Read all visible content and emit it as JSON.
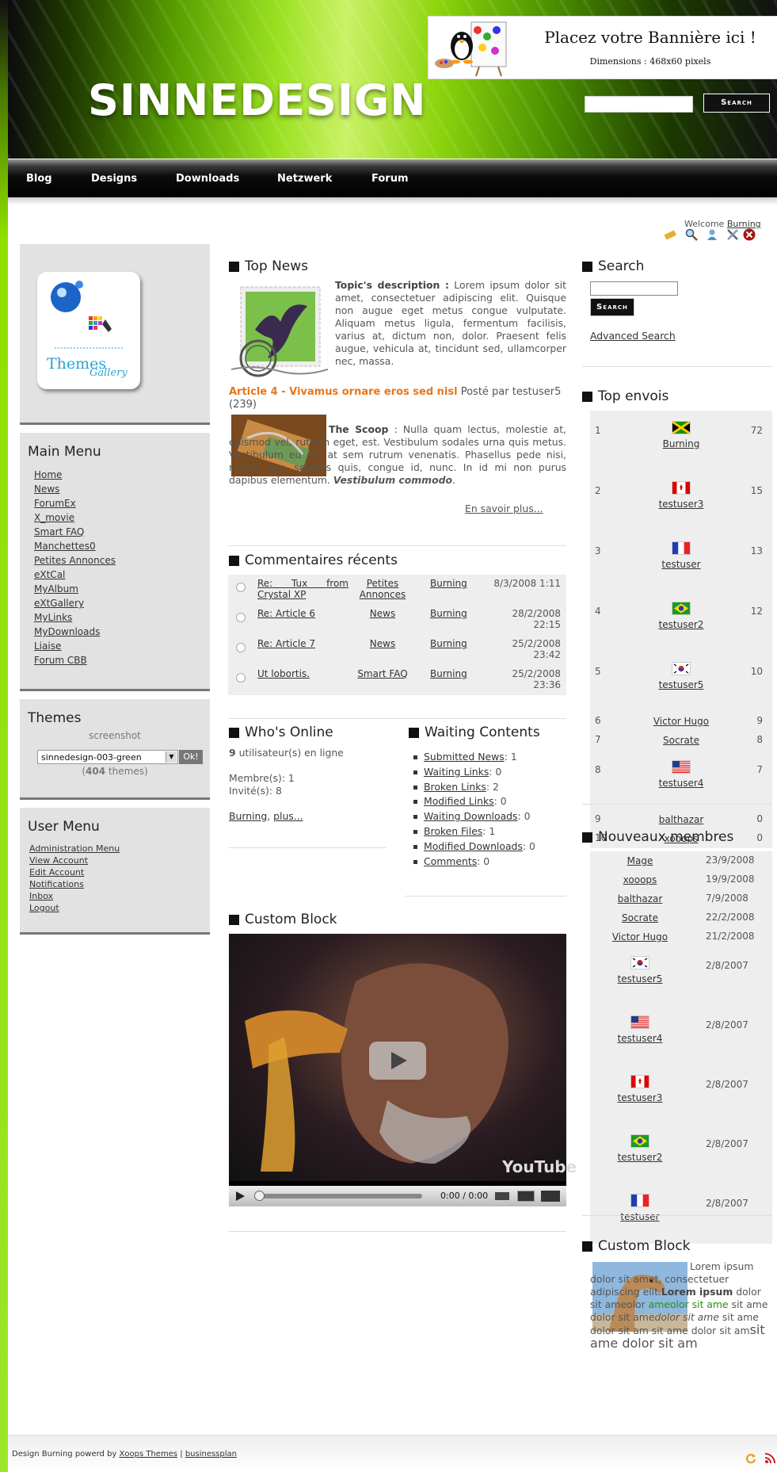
{
  "header": {
    "brand": "SINNEDESIGN",
    "banner": {
      "title": "Placez votre Bannière ici !",
      "dimensions": "Dimensions : 468x60 pixels"
    },
    "search_button": "Search"
  },
  "nav": {
    "items": [
      "Blog",
      "Designs",
      "Downloads",
      "Netzwerk",
      "Forum"
    ]
  },
  "welcome": {
    "prefix": "Welcome",
    "user": "Burning"
  },
  "tool_icons": [
    "pencil-icon",
    "magnifier-icon",
    "user-icon",
    "tools-icon",
    "close-icon"
  ],
  "left": {
    "logo": {
      "text": "Themes",
      "subtext": "Gallery"
    },
    "main_menu": {
      "title": "Main Menu",
      "items": [
        "Home",
        "News",
        "ForumEx",
        "X_movie",
        "Smart FAQ",
        "Manchettes0",
        "Petites Annonces",
        "eXtCal",
        "MyAlbum",
        "eXtGallery",
        "MyLinks",
        "MyDownloads",
        "Liaise",
        "Forum CBB"
      ]
    },
    "themes": {
      "title": "Themes",
      "screenshot_label": "screenshot",
      "selected": "sinnedesign-003-green",
      "ok": "Ok!",
      "count": "404",
      "count_suffix": "themes)"
    },
    "user_menu": {
      "title": "User Menu",
      "items": [
        "Administration Menu",
        "View Account",
        "Edit Account",
        "Notifications",
        "Inbox",
        "Logout"
      ]
    }
  },
  "center": {
    "top_news": {
      "title": "Top News",
      "desc_label": "Topic's description :",
      "desc": "Lorem ipsum dolor sit amet, consectetuer adipiscing elit. Quisque non augue eget metus congue vulputate. Aliquam metus ligula, fermentum facilisis, varius at, dictum non, dolor. Praesent felis augue, vehicula at, tincidunt sed, ullamcorper nec, massa.",
      "article_title": "Article 4 - Vivamus ornare eros sed nisl",
      "posted_by": "Posté par testuser5",
      "views": "(239)",
      "scoop_label": "The Scoop",
      "body": ": Nulla quam lectus, molestie at, euismod vel, rutrum eget, est. Vestibulum sodales urna quis metus. Vestibulum eu elit at sem rutrum venenatis. Phasellus pede nisi, mattis nec, sodales quis, congue id, nunc. In id mi non purus dapibus elementum.",
      "body_emphasis": "Vestibulum commodo",
      "read_more": "En savoir plus..."
    },
    "comments": {
      "title": "Commentaires récents",
      "rows": [
        {
          "subject": "Re: Tux from Crystal XP",
          "module": "Petites Annonces",
          "user": "Burning",
          "date": "8/3/2008 1:11"
        },
        {
          "subject": "Re: Article 6",
          "module": "News",
          "user": "Burning",
          "date": "28/2/2008 22:15"
        },
        {
          "subject": "Re: Article 7",
          "module": "News",
          "user": "Burning",
          "date": "25/2/2008 23:42"
        },
        {
          "subject": "Ut lobortis.",
          "module": "Smart FAQ",
          "user": "Burning",
          "date": "25/2/2008 23:36"
        }
      ]
    },
    "online": {
      "title": "Who's Online",
      "count": "9",
      "count_text": "utilisateur(s) en ligne",
      "members": "Membre(s): 1",
      "guests": "Invité(s): 8",
      "user": "Burning",
      "more": "plus..."
    },
    "waiting": {
      "title": "Waiting Contents",
      "items": [
        {
          "label": "Submitted News",
          "count": "1"
        },
        {
          "label": "Waiting Links",
          "count": "0"
        },
        {
          "label": "Broken Links",
          "count": "2"
        },
        {
          "label": "Modified Links",
          "count": "0"
        },
        {
          "label": "Waiting Downloads",
          "count": "0"
        },
        {
          "label": "Broken Files",
          "count": "1"
        },
        {
          "label": "Modified Downloads",
          "count": "0"
        },
        {
          "label": "Comments",
          "count": "0"
        }
      ]
    },
    "custom_block": {
      "title": "Custom Block",
      "video_time": "0:00 / 0:00",
      "logo": "YouTube"
    }
  },
  "right": {
    "search": {
      "title": "Search",
      "button": "Search",
      "advanced": "Advanced Search"
    },
    "top_posters": {
      "title": "Top envois",
      "rows": [
        {
          "rank": "1",
          "flag": "jamaica",
          "name": "Burning",
          "count": "72"
        },
        {
          "rank": "2",
          "flag": "canada",
          "name": "testuser3",
          "count": "15"
        },
        {
          "rank": "3",
          "flag": "france",
          "name": "testuser",
          "count": "13"
        },
        {
          "rank": "4",
          "flag": "brazil",
          "name": "testuser2",
          "count": "12"
        },
        {
          "rank": "5",
          "flag": "korea",
          "name": "testuser5",
          "count": "10"
        },
        {
          "rank": "6",
          "flag": "",
          "name": "Victor Hugo",
          "count": "9"
        },
        {
          "rank": "7",
          "flag": "",
          "name": "Socrate",
          "count": "8"
        },
        {
          "rank": "8",
          "flag": "usa",
          "name": "testuser4",
          "count": "7"
        },
        {
          "rank": "9",
          "flag": "",
          "name": "balthazar",
          "count": "0"
        },
        {
          "rank": "10",
          "flag": "",
          "name": "xooops",
          "count": "0"
        }
      ]
    },
    "new_members": {
      "title": "Nouveaux membres",
      "rows": [
        {
          "flag": "",
          "name": "Mage",
          "date": "23/9/2008"
        },
        {
          "flag": "",
          "name": "xooops",
          "date": "19/9/2008"
        },
        {
          "flag": "",
          "name": "balthazar",
          "date": "7/9/2008"
        },
        {
          "flag": "",
          "name": "Socrate",
          "date": "22/2/2008"
        },
        {
          "flag": "",
          "name": "Victor Hugo",
          "date": "21/2/2008"
        },
        {
          "flag": "korea",
          "name": "testuser5",
          "date": "2/8/2007"
        },
        {
          "flag": "usa",
          "name": "testuser4",
          "date": "2/8/2007"
        },
        {
          "flag": "canada",
          "name": "testuser3",
          "date": "2/8/2007"
        },
        {
          "flag": "brazil",
          "name": "testuser2",
          "date": "2/8/2007"
        },
        {
          "flag": "france",
          "name": "testuser",
          "date": "2/8/2007"
        }
      ]
    },
    "custom_block": {
      "title": "Custom Block",
      "t1": "Lorem ipsum dolor sit amet, consectetuer adipiscing elit.",
      "t2": "Lorem ipsum",
      "t3": "dolor sit ameolor",
      "t4": "ameolor sit ame",
      "t5": "sit ame dolor sit ame",
      "t6": "dolor sit ame",
      "t7": "sit ame dolor sit am sit ame dolor sit am",
      "t8": "sit ame dolor sit am"
    }
  },
  "footer": {
    "prefix": "Design Burning powerd by",
    "link1": "Xoops Themes",
    "sep": "|",
    "link2": "businessplan"
  },
  "colors": {
    "accent_green": "#8ee000",
    "article_orange": "#e8751a",
    "dark": "#111111"
  }
}
